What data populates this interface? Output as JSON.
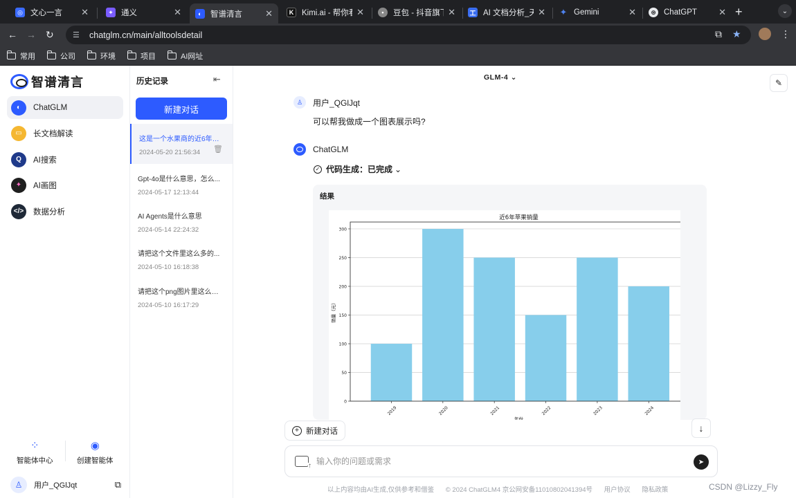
{
  "browser": {
    "tabs": [
      {
        "title": "文心一言",
        "icon": "wenxin-icon",
        "color": "#3b6bff"
      },
      {
        "title": "通义",
        "icon": "tongyi-icon",
        "color": "#7a5cff"
      },
      {
        "title": "智谱清言",
        "icon": "zhipu-icon",
        "color": "#2d5bff",
        "active": true
      },
      {
        "title": "Kimi.ai - 帮你看更",
        "icon": "kimi-icon",
        "color": "#111111"
      },
      {
        "title": "豆包 - 抖音旗下 AI",
        "icon": "doubao-icon",
        "color": "#888888"
      },
      {
        "title": "AI 文档分析_天工",
        "icon": "tiangong-icon",
        "color": "#3a6df0"
      },
      {
        "title": "Gemini",
        "icon": "gemini-icon",
        "color": "#4e82ee"
      },
      {
        "title": "ChatGPT",
        "icon": "chatgpt-icon",
        "color": "#10a37f"
      }
    ],
    "url": "chatglm.cn/main/alltoolsdetail",
    "bookmarks": [
      "常用",
      "公司",
      "环境",
      "项目",
      "AI网址"
    ]
  },
  "sidebar": {
    "brand": "智谱清言",
    "items": [
      {
        "label": "ChatGLM",
        "icon": "chatglm-icon",
        "color": "#2d5bff",
        "active": true
      },
      {
        "label": "长文档解读",
        "icon": "document-icon",
        "color": "#f5b731"
      },
      {
        "label": "AI搜索",
        "icon": "search-icon",
        "color": "#1f3a8a"
      },
      {
        "label": "AI画图",
        "icon": "paint-icon",
        "color": "#1f1f1f"
      },
      {
        "label": "数据分析",
        "icon": "code-icon",
        "color": "#1f2937"
      }
    ],
    "agent_center": "智能体中心",
    "create_agent": "创建智能体",
    "username": "用户_QGlJqt"
  },
  "history": {
    "title": "历史记录",
    "new_chat": "新建对话",
    "items": [
      {
        "title": "这是一个水果商的近6年的...",
        "date": "2024-05-20 21:56:34",
        "active": true
      },
      {
        "title": "Gpt-4o是什么意思，怎么...",
        "date": "2024-05-17 12:13:44"
      },
      {
        "title": "AI Agents是什么意思",
        "date": "2024-05-14 22:24:32"
      },
      {
        "title": "请把这个文件里这么多的...",
        "date": "2024-05-10 16:18:38"
      },
      {
        "title": "请把这个png图片里这么多...",
        "date": "2024-05-10 16:17:29"
      }
    ]
  },
  "main": {
    "model": "GLM-4",
    "user_name": "用户_QGlJqt",
    "user_message": "可以帮我做成一个图表展示吗?",
    "bot_name": "ChatGLM",
    "code_status": "代码生成：已完成",
    "result_label": "结果",
    "float_new_chat": "新建对话",
    "input_placeholder": "输入你的问题或需求",
    "footer": [
      "以上内容均由AI生成,仅供参考和借鉴",
      "© 2024 ChatGLM4 京公网安备11010802041394号",
      "用户协议",
      "隐私政策"
    ]
  },
  "watermark": "CSDN @Lizzy_Fly",
  "chart_data": {
    "type": "bar",
    "title": "近6年苹果销量",
    "xlabel": "年份",
    "ylabel": "销量（元）",
    "categories": [
      "2019",
      "2020",
      "2021",
      "2022",
      "2023",
      "2024"
    ],
    "values": [
      100,
      300,
      250,
      150,
      250,
      200
    ],
    "ylim": [
      0,
      312
    ],
    "yticks": [
      0,
      50,
      100,
      150,
      200,
      250,
      300
    ],
    "bar_color": "#87ceeb",
    "grid": true
  }
}
